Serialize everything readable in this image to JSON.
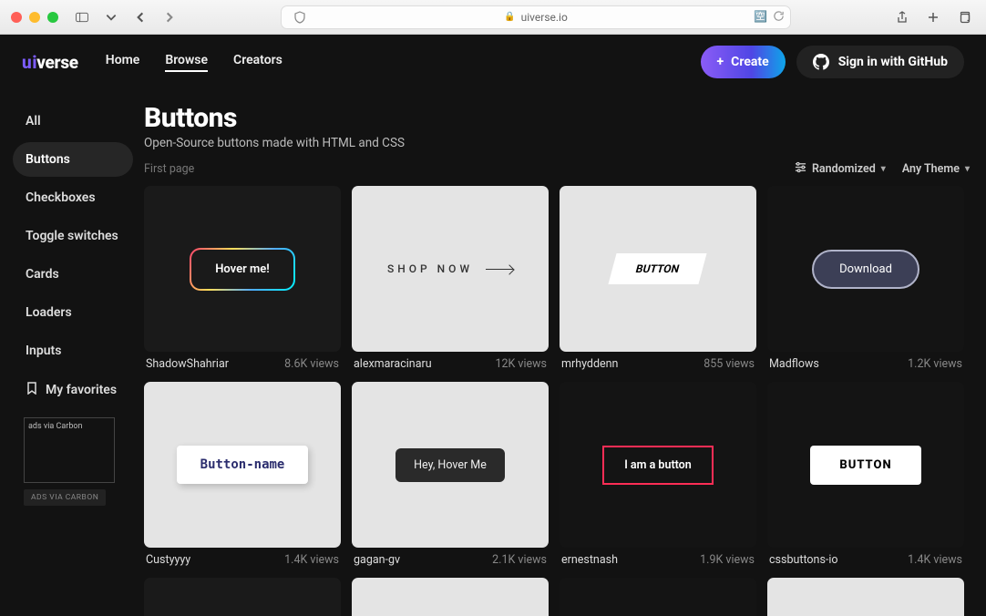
{
  "browser": {
    "url": "uiverse.io"
  },
  "nav": {
    "logo_u": "u",
    "logo_rest": "iverse",
    "home": "Home",
    "browse": "Browse",
    "creators": "Creators",
    "create": "Create",
    "signin": "Sign in with GitHub"
  },
  "sidebar": {
    "items": [
      {
        "label": "All"
      },
      {
        "label": "Buttons"
      },
      {
        "label": "Checkboxes"
      },
      {
        "label": "Toggle switches"
      },
      {
        "label": "Cards"
      },
      {
        "label": "Loaders"
      },
      {
        "label": "Inputs"
      },
      {
        "label": "My favorites"
      }
    ],
    "ad_text": "ads via Carbon",
    "ad_label": "ADS VIA CARBON"
  },
  "page": {
    "title": "Buttons",
    "subtitle": "Open-Source buttons made with HTML and CSS",
    "first_page": "First page",
    "sort": "Randomized",
    "theme": "Any Theme"
  },
  "cards": [
    {
      "preview": "Hover me!",
      "author": "ShadowShahriar",
      "views": "8.6K views"
    },
    {
      "preview": "SHOP NOW",
      "author": "alexmaracinaru",
      "views": "12K views"
    },
    {
      "preview": "BUTTON",
      "author": "mrhyddenn",
      "views": "855 views"
    },
    {
      "preview": "Download",
      "author": "Madflows",
      "views": "1.2K views"
    },
    {
      "preview": "Button-name",
      "author": "Custyyyy",
      "views": "1.4K views"
    },
    {
      "preview": "Hey, Hover Me",
      "author": "gagan-gv",
      "views": "2.1K views"
    },
    {
      "preview": "I am a button",
      "author": "ernestnash",
      "views": "1.9K views"
    },
    {
      "preview": "BUTTON",
      "author": "cssbuttons-io",
      "views": "1.4K views"
    }
  ]
}
